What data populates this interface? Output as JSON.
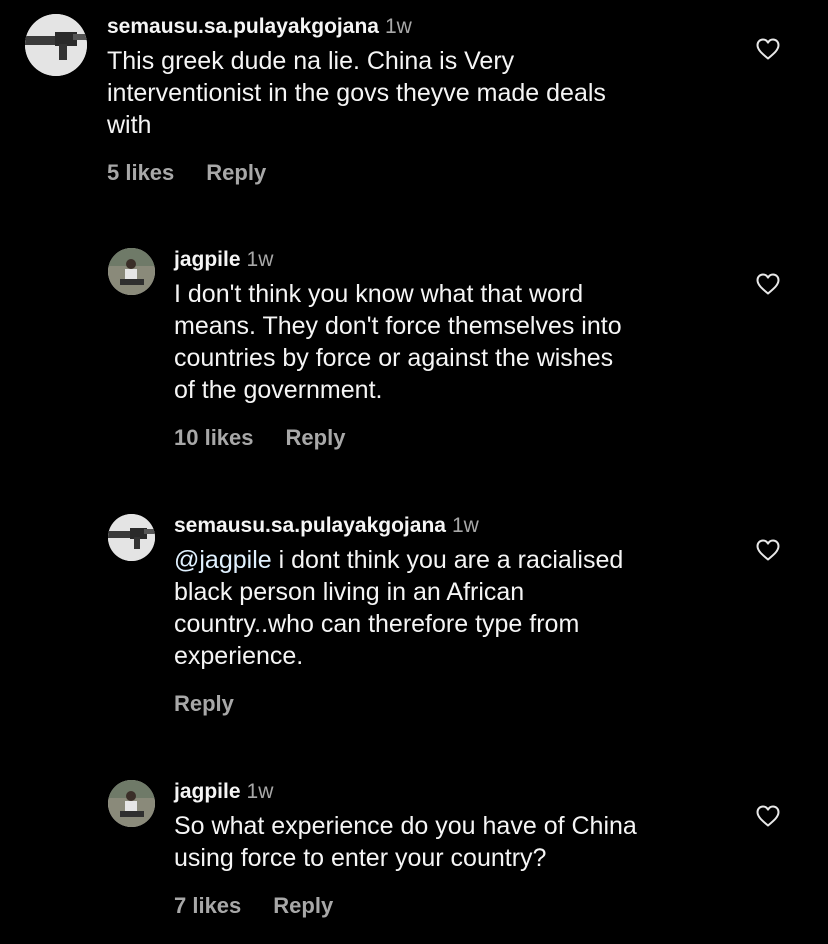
{
  "comments": [
    {
      "username": "semausu.sa.pulayakgojana",
      "time": "1w",
      "text_lines": [
        "This greek dude na lie. China is Very",
        "interventionist in the govs theyve made deals",
        "with"
      ],
      "likes": "5 likes",
      "reply": "Reply",
      "avatar_icon": "gun-avatar"
    },
    {
      "username": "jagpile",
      "time": "1w",
      "text_lines": [
        "I don't think you know what that word",
        "means. They don't force themselves into",
        "countries by force or against the wishes",
        "of the government."
      ],
      "likes": "10 likes",
      "reply": "Reply",
      "avatar_icon": "person-sitting-avatar"
    },
    {
      "username": "semausu.sa.pulayakgojana",
      "time": "1w",
      "mention": "@jagpile",
      "text_lines": [
        "i dont think you are a racialised",
        "black person living in an African",
        "country..who can therefore type from",
        "experience."
      ],
      "reply": "Reply",
      "avatar_icon": "gun-avatar"
    },
    {
      "username": "jagpile",
      "time": "1w",
      "text_lines": [
        "So what experience do you have of China",
        "using force to enter your country?"
      ],
      "likes": "7 likes",
      "reply": "Reply",
      "avatar_icon": "person-sitting-avatar"
    }
  ],
  "colors": {
    "background": "#000000",
    "text": "#f5f5f5",
    "secondary": "#a8a8a8",
    "mention": "#e0f1ff"
  }
}
